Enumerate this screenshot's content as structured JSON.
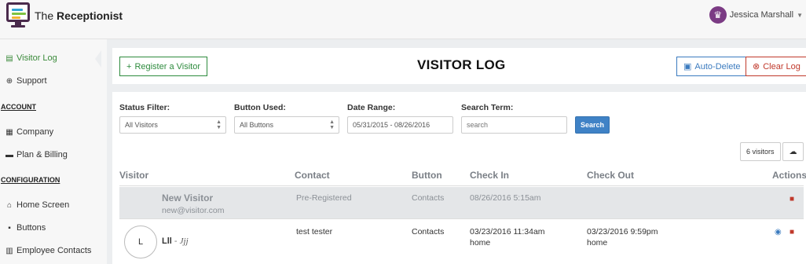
{
  "app": {
    "brand_prefix": "The",
    "brand_name": "Receptionist",
    "user_initial": "♛",
    "user_name": "Jessica Marshall"
  },
  "sidebar": {
    "items": [
      {
        "label": "Visitor Log",
        "icon": "document-icon",
        "active": true
      },
      {
        "label": "Support",
        "icon": "lifebuoy-icon"
      }
    ],
    "account_header": "ACCOUNT",
    "account_items": [
      {
        "label": "Company",
        "icon": "building-icon"
      },
      {
        "label": "Plan & Billing",
        "icon": "credit-card-icon"
      }
    ],
    "config_header": "CONFIGURATION",
    "config_items": [
      {
        "label": "Home Screen",
        "icon": "home-icon"
      },
      {
        "label": "Buttons",
        "icon": "grid-icon"
      },
      {
        "label": "Employee Contacts",
        "icon": "address-book-icon"
      }
    ]
  },
  "header": {
    "register_label": "Register a Visitor",
    "title": "VISITOR LOG",
    "auto_delete_label": "Auto-Delete",
    "clear_log_label": "Clear Log"
  },
  "filters": {
    "status_label": "Status Filter:",
    "status_value": "All Visitors",
    "button_label": "Button Used:",
    "button_value": "All Buttons",
    "date_label": "Date Range:",
    "date_value": "05/31/2015 - 08/26/2016",
    "search_label": "Search Term:",
    "search_placeholder": "search",
    "search_button": "Search"
  },
  "summary": {
    "count_label": "6 visitors"
  },
  "table": {
    "headers": {
      "visitor": "Visitor",
      "contact": "Contact",
      "button": "Button",
      "checkin": "Check In",
      "checkout": "Check Out",
      "actions": "Actions"
    },
    "rows": [
      {
        "name": "New Visitor",
        "email": "new@visitor.com",
        "contact": "Pre-Registered",
        "button": "Contacts",
        "checkin": "08/26/2016 5:15am",
        "checkout": ""
      },
      {
        "avatar_initial": "L",
        "name": "Lll",
        "signature": "Jjj",
        "contact": "test tester",
        "button": "Contacts",
        "checkin": "03/23/2016 11:34am",
        "checkin_location": "home",
        "checkout": "03/23/2016 9:59pm",
        "checkout_location": "home"
      }
    ]
  },
  "colors": {
    "green": "#2e8b3e",
    "blue": "#3b7bbf",
    "red": "#c0392b",
    "purple": "#4a2a4c"
  }
}
